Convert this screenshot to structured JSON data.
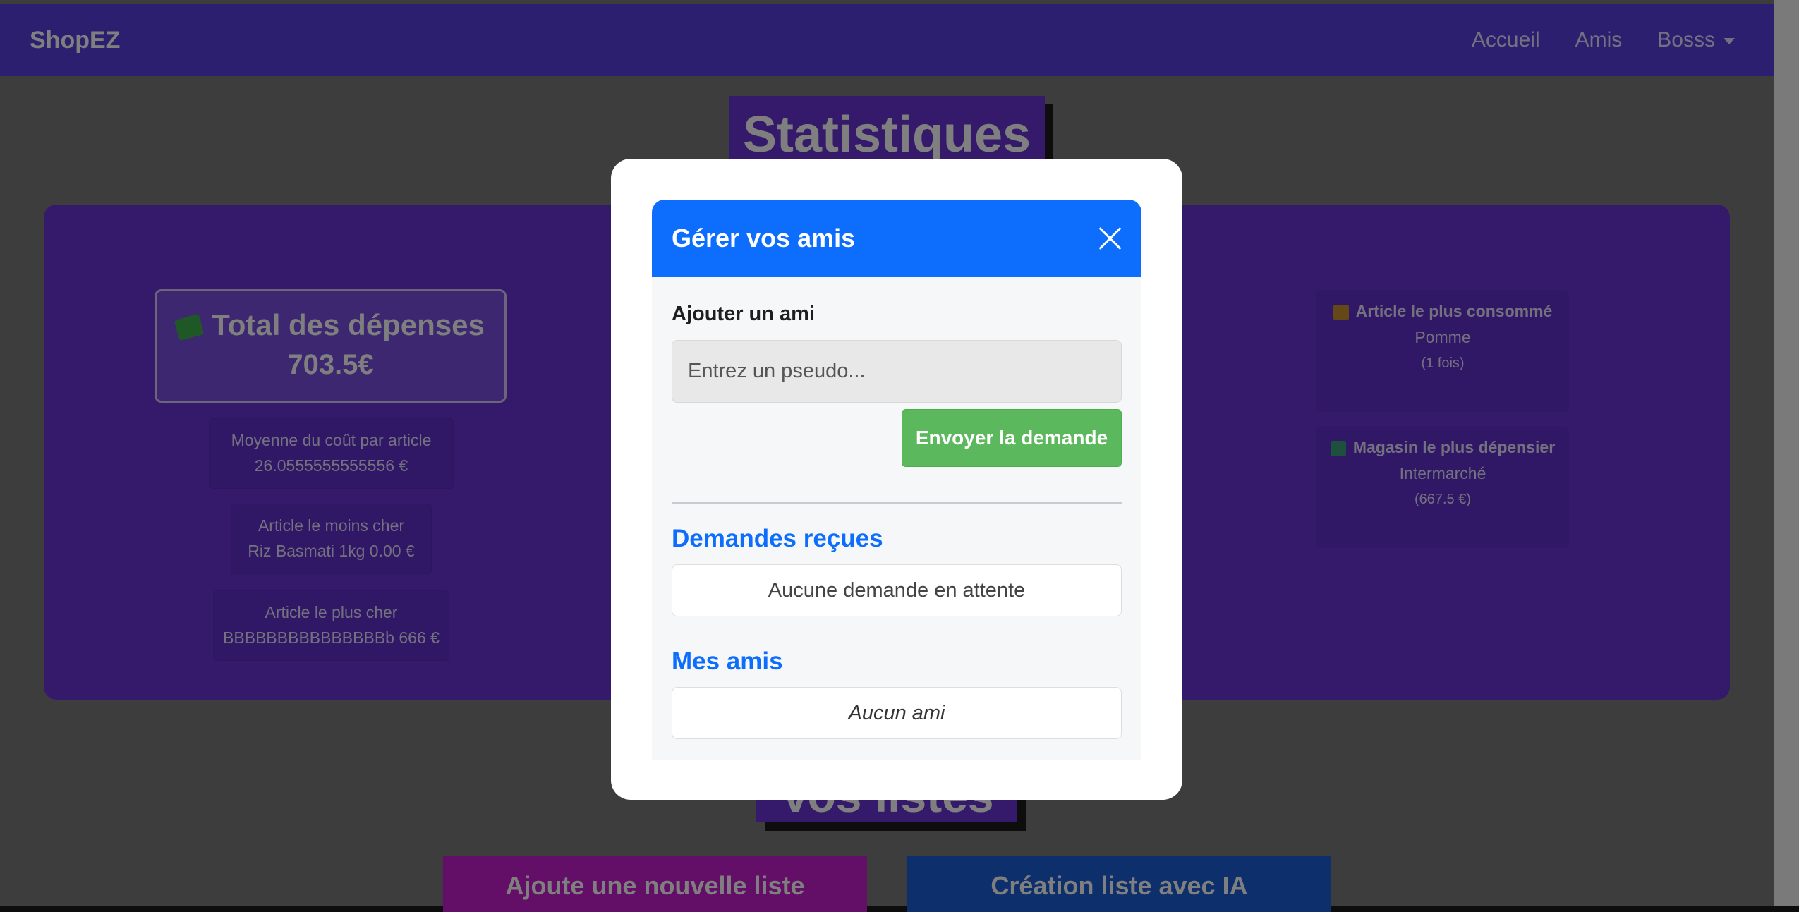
{
  "navbar": {
    "brand": "ShopEZ",
    "links": [
      "Accueil",
      "Amis"
    ],
    "user_menu": "Bosss"
  },
  "stats": {
    "title": "Statistiques",
    "total_label": "Total des dépenses",
    "total_value": "703.5€",
    "avg_label": "Moyenne du coût par article",
    "avg_value": "26.0555555555556 €",
    "cheapest_label": "Article le moins cher",
    "cheapest_value": "Riz Basmati 1kg 0.00 €",
    "priciest_label": "Article le plus cher",
    "priciest_value": "BBBBBBBBBBBBBBBb 666 €",
    "most_consumed_label": "Article le plus consommé",
    "most_consumed_value": "Pomme",
    "most_consumed_count": "(1 fois)",
    "top_store_label": "Magasin le plus dépensier",
    "top_store_value": "Intermarché",
    "top_store_amount": "(667.5 €)"
  },
  "lists": {
    "title": "Vos listes",
    "new_list_button": "Ajoute une nouvelle liste",
    "ai_list_button": "Création liste avec IA"
  },
  "modal": {
    "title": "Gérer vos amis",
    "add_friend_label": "Ajouter un ami",
    "pseudo_placeholder": "Entrez un pseudo...",
    "send_button": "Envoyer la demande",
    "requests_title": "Demandes reçues",
    "requests_empty": "Aucune demande en attente",
    "friends_title": "Mes amis",
    "friends_empty": "Aucun ami"
  },
  "colors": {
    "navbar": "#5b3ee0",
    "panel": "#6b35d9",
    "modal_header": "#0d6efd",
    "send_button": "#5cb85c",
    "section_title": "#0d6efd",
    "new_list_button": "#c61fd1",
    "ai_list_button": "#1b5fd8"
  },
  "icons": [
    "money-icon",
    "box-icon",
    "shop-icon",
    "close-icon",
    "caret-down-icon"
  ]
}
